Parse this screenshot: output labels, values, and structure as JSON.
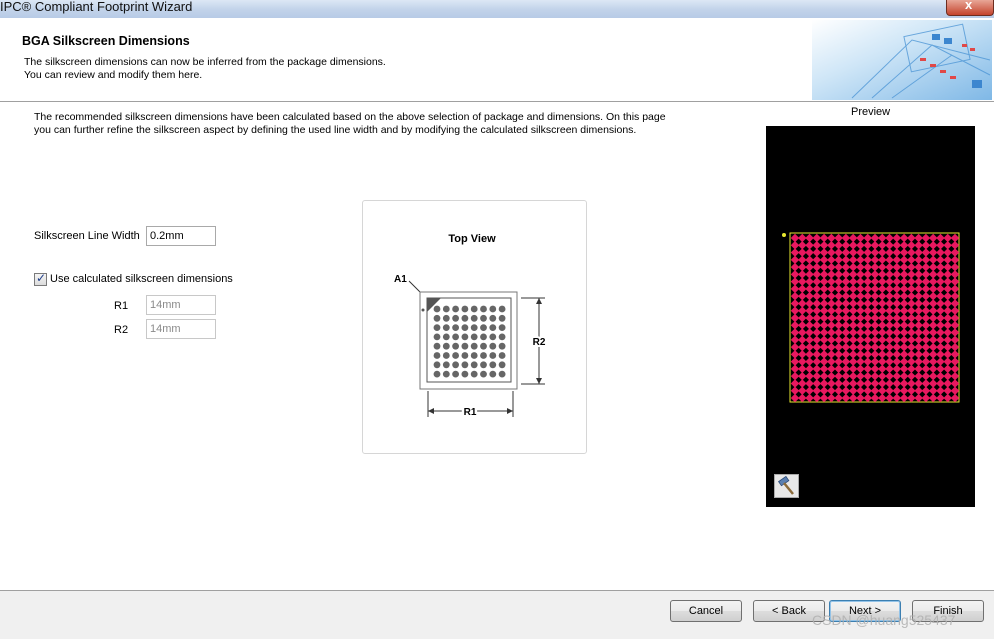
{
  "window": {
    "title": "IPC® Compliant Footprint Wizard",
    "close_glyph": "x"
  },
  "header": {
    "title": "BGA Silkscreen Dimensions",
    "subtitle_line1": "The silkscreen dimensions can now be inferred from the package dimensions.",
    "subtitle_line2": "You can review and modify them here."
  },
  "description": "The recommended silkscreen dimensions have been calculated based on the above selection of package and dimensions. On this page you can further refine the silkscreen aspect by defining the used line width and by modifying the calculated silkscreen dimensions.",
  "form": {
    "line_width_label": "Silkscreen Line Width",
    "line_width_value": "0.2mm",
    "use_calculated_label": "Use calculated silkscreen dimensions",
    "use_calculated_checked": true,
    "r1_label": "R1",
    "r1_value": "14mm",
    "r2_label": "R2",
    "r2_value": "14mm"
  },
  "diagram": {
    "title": "Top View",
    "a1_label": "A1",
    "r1_label": "R1",
    "r2_label": "R2",
    "ball_rows": 8,
    "ball_cols": 8
  },
  "preview": {
    "label": "Preview",
    "grid_rows": 23,
    "grid_cols": 23,
    "pad_color": "#e8185f",
    "outline_color": "#e8e830"
  },
  "footer": {
    "cancel": "Cancel",
    "back": "< Back",
    "next": "Next >",
    "finish": "Finish"
  },
  "watermark": "CSDN @huang525437"
}
